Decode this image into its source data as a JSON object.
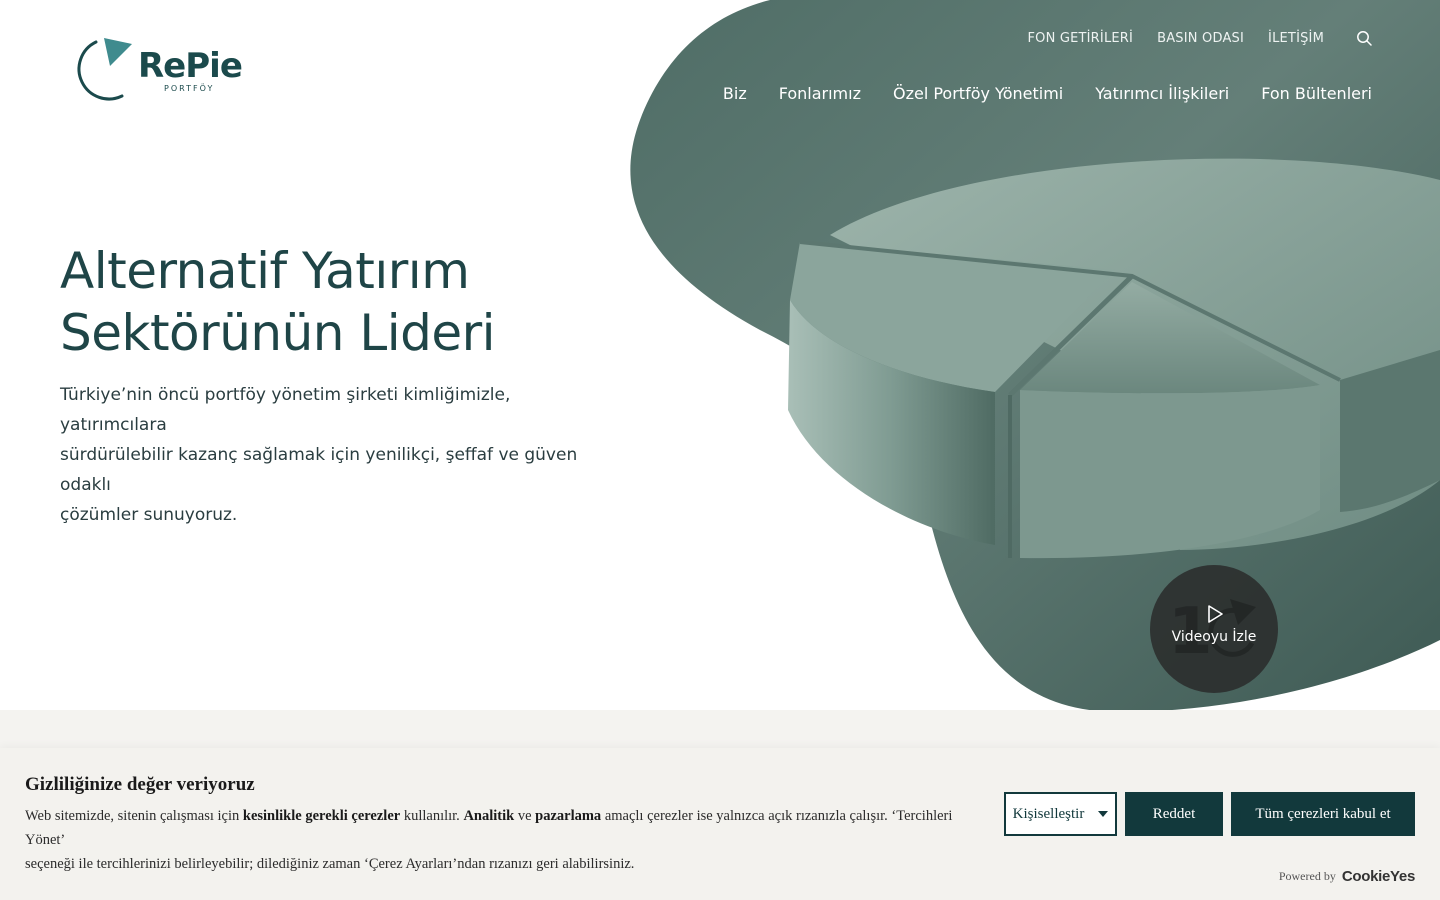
{
  "brand": {
    "name": "RePie",
    "sub": "PORTFÖY"
  },
  "util_nav": [
    {
      "label": "FON GETİRİLERİ"
    },
    {
      "label": "BASIN ODASI"
    },
    {
      "label": "İLETİŞİM"
    }
  ],
  "main_nav": [
    {
      "label": "Biz"
    },
    {
      "label": "Fonlarımız"
    },
    {
      "label": "Özel Portföy Yönetimi"
    },
    {
      "label": "Yatırımcı İlişkileri"
    },
    {
      "label": "Fon Bültenleri"
    }
  ],
  "hero": {
    "title_line1": "Alternatif Yatırım",
    "title_line2": "Sektörünün Lideri",
    "desc_line1": "Türkiye’nin öncü portföy yönetim şirketi kimliğimizle, yatırımcılara",
    "desc_line2": "sürdürülebilir kazanç sağlamak için yenilikçi, şeffaf ve güven odaklı",
    "desc_line3": "çözümler sunuyoruz."
  },
  "video": {
    "label": "Videoyu İzle"
  },
  "cookie": {
    "title": "Gizliliğinize değer veriyoruz",
    "t1": "Web sitemizde, sitenin çalışması için ",
    "b1": "kesinlikle gerekli çerezler",
    "t2": " kullanılır. ",
    "b2": "Analitik",
    "t3": " ve ",
    "b3": "pazarlama",
    "t4": " amaçlı çerezler ise yalnızca açık rızanızla çalışır. ‘Tercihleri Yönet’",
    "t5": "seçeneği ile tercihlerinizi belirleyebilir; dilediğiniz zaman ‘Çerez Ayarları’ndan rızanızı geri alabilirsiniz.",
    "customize": "Kişiselleştir",
    "reject": "Reddet",
    "accept": "Tüm çerezleri kabul et",
    "powered_by": "Powered by",
    "powered_brand": "CookieYes"
  },
  "colors": {
    "brand_dark": "#12393c",
    "hero_green": "#5f7f76",
    "banner_bg": "#f3f2ee"
  },
  "icons": {
    "search": "search-icon",
    "play": "play-icon",
    "caret": "caret-down-icon"
  }
}
